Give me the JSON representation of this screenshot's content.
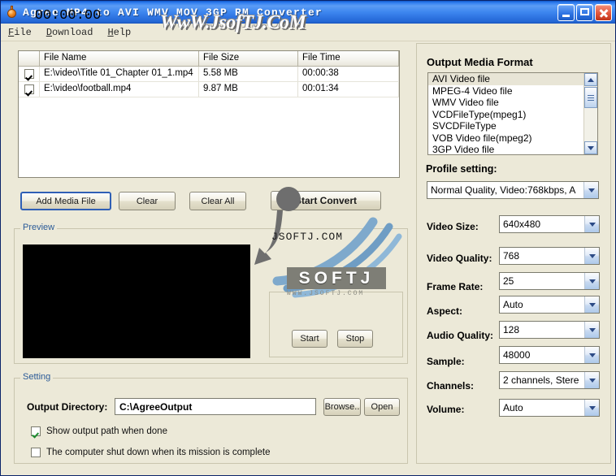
{
  "window": {
    "title": "Agree MP4 to AVI WMV MOV 3GP RM Converter",
    "icon": "flask-icon",
    "minimize_label": "Minimize",
    "maximize_label": "Maximize",
    "close_label": "Close"
  },
  "menubar": {
    "items": [
      {
        "label": "File",
        "mnemonic": "F"
      },
      {
        "label": "Download",
        "mnemonic": "D"
      },
      {
        "label": "Help",
        "mnemonic": "H"
      }
    ]
  },
  "file_list": {
    "columns": [
      "",
      "File Name",
      "File Size",
      "File Time"
    ],
    "rows": [
      {
        "checked": true,
        "name": "E:\\video\\Title 01_Chapter 01_1.mp4",
        "size": "5.58 MB",
        "time": "00:00:38"
      },
      {
        "checked": true,
        "name": "E:\\video\\football.mp4",
        "size": "9.87 MB",
        "time": "00:01:34"
      }
    ]
  },
  "toolbar": {
    "add_media_label": "Add Media File",
    "clear_label": "Clear",
    "clear_all_label": "Clear All",
    "start_convert_label": "Start Convert"
  },
  "preview": {
    "group_title": "Preview",
    "timer": "00:00:00",
    "start_label": "Start",
    "stop_label": "Stop"
  },
  "output_format": {
    "title": "Output Media Format",
    "items": [
      "AVI Video file",
      "MPEG-4 Video file",
      "WMV Video file",
      "VCDFileType(mpeg1)",
      "SVCDFileType",
      "VOB Video file(mpeg2)",
      "3GP Video file"
    ],
    "selected_index": 0
  },
  "profile": {
    "label": "Profile setting:",
    "value": "Normal Quality, Video:768kbps, A"
  },
  "settings_rows": [
    {
      "label": "Video Size:",
      "value": "640x480"
    },
    {
      "label": "Video Quality:",
      "value": "768"
    },
    {
      "label": "Frame Rate:",
      "value": "25"
    },
    {
      "label": "Aspect:",
      "value": "Auto"
    },
    {
      "label": "Audio Quality:",
      "value": "128"
    },
    {
      "label": "Sample:",
      "value": "48000"
    },
    {
      "label": "Channels:",
      "value": "2 channels, Stere"
    },
    {
      "label": "Volume:",
      "value": "Auto"
    }
  ],
  "setting": {
    "group_title": "Setting",
    "output_dir_label": "Output Directory:",
    "output_dir_value": "C:\\AgreeOutput",
    "browse_label": "Browse..",
    "open_label": "Open",
    "show_path_label": "Show output path when done",
    "show_path_checked": true,
    "shutdown_label": "The computer shut down when its mission is complete",
    "shutdown_checked": false
  },
  "watermarks": {
    "top": "WwW.JsofTJ.CoM",
    "jsoftj_dotcom": "JSOFTJ.COM",
    "softj": "SOFTJ",
    "softj_sub": "WWW.JSOFTJ.COM"
  },
  "colors": {
    "window_bg": "#ece9d8",
    "titlebar_blue": "#2f7df0",
    "group_title": "#2a5a97",
    "preview_black": "#000000",
    "check_green": "#1e8c30"
  }
}
